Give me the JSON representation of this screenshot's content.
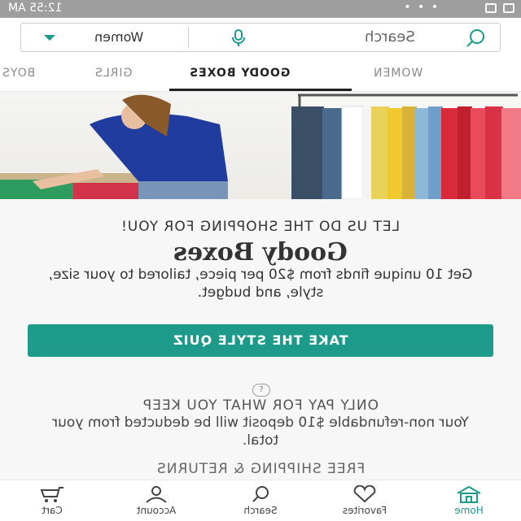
{
  "status_bar": {
    "time": "12:55 AM",
    "battery": "64%",
    "dots": "• • •"
  },
  "search": {
    "dropdown_label": "Women",
    "placeholder": "Search"
  },
  "tabs": [
    {
      "label": "WOMEN",
      "active": false
    },
    {
      "label": "GOODY BOXES",
      "active": true
    },
    {
      "label": "GIRLS",
      "active": false
    },
    {
      "label": "BOYS",
      "active": false
    }
  ],
  "promo": {
    "kicker": "LET US DO THE SHOPPING FOR YOU!",
    "headline": "Goody Boxes",
    "description": "Get 10 unique finds from $20 per piece, tailored to your size, style, and budget.",
    "cta_label": "TAKE THE STYLE QUIZ",
    "help": "?",
    "pay_title": "ONLY PAY FOR WHAT YOU KEEP",
    "pay_text": "Your non-refundable $10 deposit will be deducted from your total.",
    "shipping_title": "FREE SHIPPING & RETURNS"
  },
  "bottom_nav": [
    {
      "label": "Home",
      "icon": "home-icon",
      "active": true
    },
    {
      "label": "Favorites",
      "icon": "heart-icon",
      "active": false
    },
    {
      "label": "Search",
      "icon": "search-icon",
      "active": false
    },
    {
      "label": "Account",
      "icon": "person-icon",
      "active": false
    },
    {
      "label": "Cart",
      "icon": "cart-icon",
      "active": false
    }
  ],
  "colors": {
    "accent": "#1d9a8a",
    "status_bar": "#9e9e9e"
  }
}
